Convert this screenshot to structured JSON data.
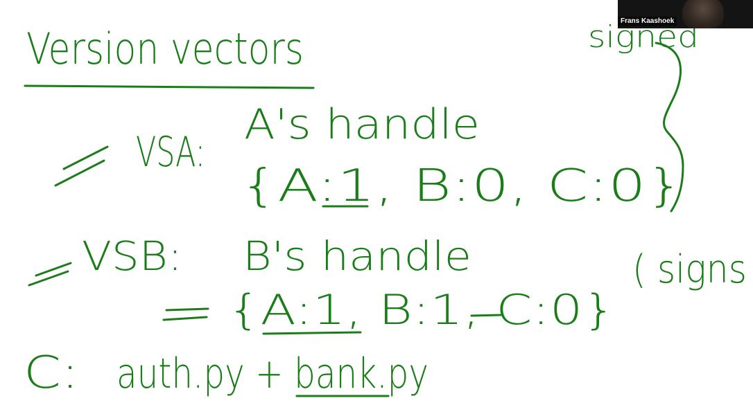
{
  "ink_color": "#1a7d1a",
  "participant": {
    "name": "Frans Kaashoek"
  },
  "board": {
    "title": "Version vectors",
    "vs_a_label": "VSA:",
    "vs_a_desc": "A's handle",
    "vs_a_vector": "{A:1, B:0, C:0}",
    "signed_note": "signed",
    "vs_b_label": "VSB:",
    "vs_b_desc": "B's handle",
    "vs_b_vector": "{A:1, B:1, C:0}",
    "signs_note": "( signs",
    "c_label": "C:",
    "c_files": "auth.py + bank.py"
  }
}
